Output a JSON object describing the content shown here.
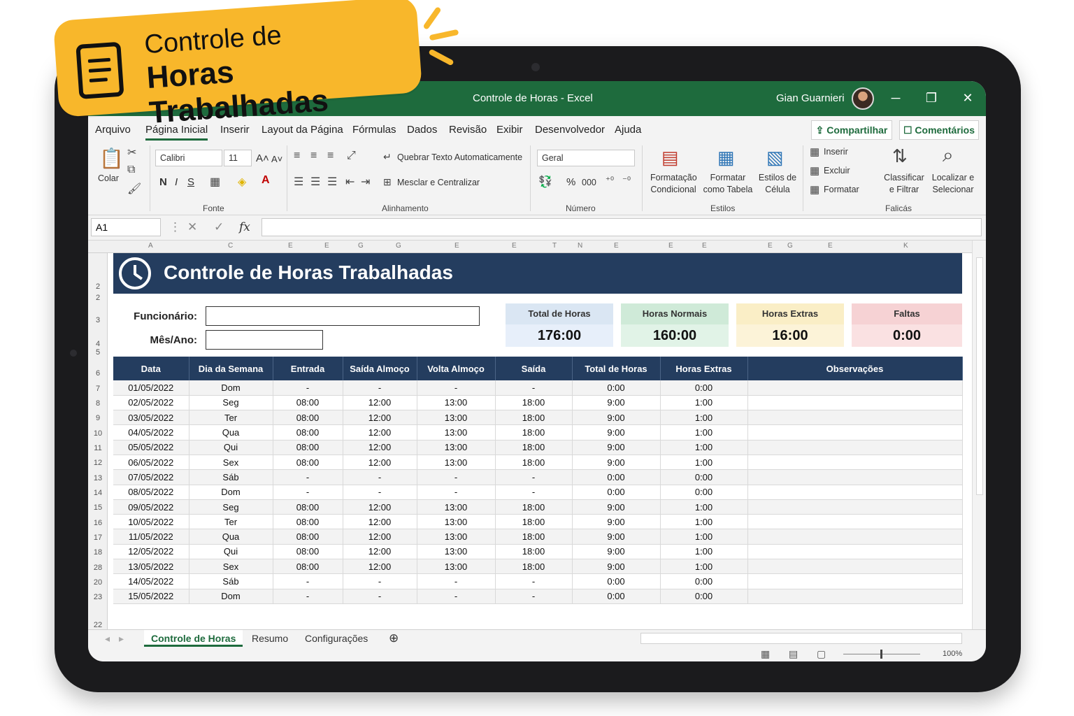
{
  "badge": {
    "line1": "Controle de",
    "line2": "Horas Trabalhadas"
  },
  "window": {
    "doc_title": "Controle de Horas  -  Excel",
    "user": "Gian Guarnieri",
    "minimize": "─",
    "restore": "❐",
    "close": "✕"
  },
  "menu": {
    "items": [
      "Arquivo",
      "Página Inicial",
      "Inserir",
      "Layout da Página",
      "Fórmulas",
      "Dados",
      "Revisão",
      "Exibir",
      "Desenvolvedor",
      "Ajuda"
    ],
    "share": "⇪ Compartilhar",
    "comments": "☐ Comentários"
  },
  "ribbon": {
    "paste": "Colar",
    "font_name": "Calibri",
    "font_size": "11",
    "bold": "N",
    "italic": "I",
    "underline": "S",
    "grow": "A˄",
    "shrink": "A˅",
    "wrap": "Quebrar Texto Automaticamente",
    "merge": "Mesclar e Centralizar",
    "number_format": "Geral",
    "percent": "%",
    "thousands": "000",
    "cond_format": "Formatação Condicional",
    "format_table": "Formatar como Tabela",
    "cell_styles": "Estilos de Célula",
    "insert": "Inserir",
    "delete": "Excluir",
    "format": "Formatar",
    "sort": "Classificar e Filtrar",
    "find": "Localizar e Selecionar",
    "groups": {
      "font": "Fonte",
      "align": "Alinhamento",
      "number": "Número",
      "styles": "Estilos",
      "tools": "Falicás"
    }
  },
  "formula": {
    "name_box": "A1",
    "fx": "fx"
  },
  "columns": [
    "A",
    "",
    "C",
    "E",
    "E",
    "G",
    "G",
    "E",
    "E",
    "T",
    "N",
    "E",
    "E",
    "E",
    "E",
    "G",
    "E",
    "K"
  ],
  "rows": [
    "2",
    "2",
    "3",
    "4",
    "5",
    "6",
    "7",
    "8",
    "9",
    "10",
    "11",
    "12",
    "13",
    "14",
    "15",
    "16",
    "17",
    "18",
    "28",
    "20",
    "23",
    "22"
  ],
  "sheet": {
    "title": "Controle de Horas Trabalhadas",
    "employee_label": "Funcionário:",
    "month_label": "Mês/Ano:",
    "cards": [
      {
        "title": "Total de Horas",
        "value": "176:00",
        "head": "#dae6f3",
        "body": "#e7effa"
      },
      {
        "title": "Horas Normais",
        "value": "160:00",
        "head": "#cfead8",
        "body": "#e1f3e7"
      },
      {
        "title": "Horas Extras",
        "value": "16:00",
        "head": "#faeec6",
        "body": "#fcf3d8"
      },
      {
        "title": "Faltas",
        "value": "0:00",
        "head": "#f6d2d4",
        "body": "#fae1e2"
      }
    ],
    "headers": [
      "Data",
      "Dia da Semana",
      "Entrada",
      "Saída Almoço",
      "Volta Almoço",
      "Saída",
      "Total de Horas",
      "Horas Extras",
      "Observações"
    ],
    "data": [
      [
        "01/05/2022",
        "Dom",
        "-",
        "-",
        "-",
        "-",
        "0:00",
        "0:00",
        ""
      ],
      [
        "02/05/2022",
        "Seg",
        "08:00",
        "12:00",
        "13:00",
        "18:00",
        "9:00",
        "1:00",
        ""
      ],
      [
        "03/05/2022",
        "Ter",
        "08:00",
        "12:00",
        "13:00",
        "18:00",
        "9:00",
        "1:00",
        ""
      ],
      [
        "04/05/2022",
        "Qua",
        "08:00",
        "12:00",
        "13:00",
        "18:00",
        "9:00",
        "1:00",
        ""
      ],
      [
        "05/05/2022",
        "Qui",
        "08:00",
        "12:00",
        "13:00",
        "18:00",
        "9:00",
        "1:00",
        ""
      ],
      [
        "06/05/2022",
        "Sex",
        "08:00",
        "12:00",
        "13:00",
        "18:00",
        "9:00",
        "1:00",
        ""
      ],
      [
        "07/05/2022",
        "Sáb",
        "-",
        "-",
        "-",
        "-",
        "0:00",
        "0:00",
        ""
      ],
      [
        "08/05/2022",
        "Dom",
        "-",
        "-",
        "-",
        "-",
        "0:00",
        "0:00",
        ""
      ],
      [
        "09/05/2022",
        "Seg",
        "08:00",
        "12:00",
        "13:00",
        "18:00",
        "9:00",
        "1:00",
        ""
      ],
      [
        "10/05/2022",
        "Ter",
        "08:00",
        "12:00",
        "13:00",
        "18:00",
        "9:00",
        "1:00",
        ""
      ],
      [
        "11/05/2022",
        "Qua",
        "08:00",
        "12:00",
        "13:00",
        "18:00",
        "9:00",
        "1:00",
        ""
      ],
      [
        "12/05/2022",
        "Qui",
        "08:00",
        "12:00",
        "13:00",
        "18:00",
        "9:00",
        "1:00",
        ""
      ],
      [
        "13/05/2022",
        "Sex",
        "08:00",
        "12:00",
        "13:00",
        "18:00",
        "9:00",
        "1:00",
        ""
      ],
      [
        "14/05/2022",
        "Sáb",
        "-",
        "-",
        "-",
        "-",
        "0:00",
        "0:00",
        ""
      ],
      [
        "15/05/2022",
        "Dom",
        "-",
        "-",
        "-",
        "-",
        "0:00",
        "0:00",
        ""
      ]
    ]
  },
  "tabs": [
    "Controle de Horas",
    "Resumo",
    "Configurações"
  ],
  "add_sheet": "⊕",
  "zoom": "100%",
  "colors": {
    "excel_green": "#1e6b3d",
    "navy": "#243d5f",
    "badge": "#f8b72b"
  }
}
